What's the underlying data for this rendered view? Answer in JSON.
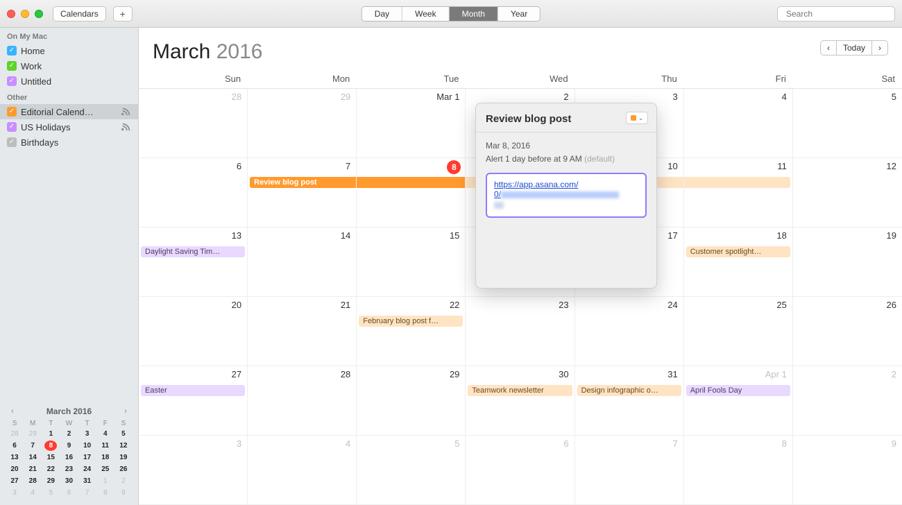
{
  "toolbar": {
    "calendars_btn": "Calendars",
    "views": {
      "day": "Day",
      "week": "Week",
      "month": "Month",
      "year": "Year",
      "active": "Month"
    },
    "search_placeholder": "Search"
  },
  "sidebar": {
    "group1_title": "On My Mac",
    "group1": [
      {
        "label": "Home",
        "color": "blue",
        "checked": true
      },
      {
        "label": "Work",
        "color": "green",
        "checked": true
      },
      {
        "label": "Untitled",
        "color": "purple",
        "checked": true
      }
    ],
    "group2_title": "Other",
    "group2": [
      {
        "label": "Editorial Calend…",
        "color": "orange",
        "checked": true,
        "rss": true,
        "selected": true
      },
      {
        "label": "US Holidays",
        "color": "purple",
        "checked": true,
        "rss": true
      },
      {
        "label": "Birthdays",
        "color": "gray",
        "checked": true
      }
    ]
  },
  "miniCal": {
    "title": "March 2016",
    "dow": [
      "S",
      "M",
      "T",
      "W",
      "T",
      "F",
      "S"
    ],
    "rows": [
      [
        {
          "n": "28",
          "dim": true
        },
        {
          "n": "29",
          "dim": true
        },
        {
          "n": "1",
          "bold": true
        },
        {
          "n": "2",
          "bold": true
        },
        {
          "n": "3",
          "bold": true
        },
        {
          "n": "4",
          "bold": true
        },
        {
          "n": "5",
          "bold": true
        }
      ],
      [
        {
          "n": "6",
          "bold": true
        },
        {
          "n": "7",
          "bold": true
        },
        {
          "n": "8",
          "today": true
        },
        {
          "n": "9",
          "bold": true
        },
        {
          "n": "10",
          "bold": true
        },
        {
          "n": "11",
          "bold": true
        },
        {
          "n": "12",
          "bold": true
        }
      ],
      [
        {
          "n": "13",
          "bold": true
        },
        {
          "n": "14",
          "bold": true
        },
        {
          "n": "15",
          "bold": true
        },
        {
          "n": "16",
          "bold": true
        },
        {
          "n": "17",
          "bold": true
        },
        {
          "n": "18",
          "bold": true
        },
        {
          "n": "19",
          "bold": true
        }
      ],
      [
        {
          "n": "20",
          "bold": true
        },
        {
          "n": "21",
          "bold": true
        },
        {
          "n": "22",
          "bold": true
        },
        {
          "n": "23",
          "bold": true
        },
        {
          "n": "24",
          "bold": true
        },
        {
          "n": "25",
          "bold": true
        },
        {
          "n": "26",
          "bold": true
        }
      ],
      [
        {
          "n": "27",
          "bold": true
        },
        {
          "n": "28",
          "bold": true
        },
        {
          "n": "29",
          "bold": true
        },
        {
          "n": "30",
          "bold": true
        },
        {
          "n": "31",
          "bold": true
        },
        {
          "n": "1",
          "dim": true
        },
        {
          "n": "2",
          "dim": true
        }
      ],
      [
        {
          "n": "3",
          "dim": true
        },
        {
          "n": "4",
          "dim": true
        },
        {
          "n": "5",
          "dim": true
        },
        {
          "n": "6",
          "dim": true
        },
        {
          "n": "7",
          "dim": true
        },
        {
          "n": "8",
          "dim": true
        },
        {
          "n": "9",
          "dim": true
        }
      ]
    ]
  },
  "header": {
    "month": "March",
    "year": "2016",
    "today_btn": "Today",
    "dow": [
      "Sun",
      "Mon",
      "Tue",
      "Wed",
      "Thu",
      "Fri",
      "Sat"
    ]
  },
  "calendar": {
    "rows": [
      [
        {
          "num": "28",
          "dim": true
        },
        {
          "num": "29",
          "dim": true
        },
        {
          "num": "Mar 1"
        },
        {
          "num": "2"
        },
        {
          "num": "3"
        },
        {
          "num": "4"
        },
        {
          "num": "5"
        }
      ],
      [
        {
          "num": "6"
        },
        {
          "num": "7",
          "events": [
            {
              "text": "Review blog post",
              "cls": "orange-solid span left-round",
              "indentLeft": true
            }
          ]
        },
        {
          "num": "8",
          "today": true,
          "events": [
            {
              "text": "",
              "cls": "orange-solid span"
            }
          ]
        },
        {
          "num": "9",
          "events": [
            {
              "text": "",
              "cls": "orange-soft span"
            }
          ]
        },
        {
          "num": "10",
          "events": [
            {
              "text": "",
              "cls": "orange-soft span"
            }
          ]
        },
        {
          "num": "11",
          "events": [
            {
              "text": "",
              "cls": "orange-soft span right-round"
            }
          ]
        },
        {
          "num": "12"
        }
      ],
      [
        {
          "num": "13",
          "events": [
            {
              "text": "Daylight Saving Tim…",
              "cls": "purple-soft"
            }
          ]
        },
        {
          "num": "14"
        },
        {
          "num": "15"
        },
        {
          "num": "16"
        },
        {
          "num": "17"
        },
        {
          "num": "18",
          "events": [
            {
              "text": "Customer spotlight…",
              "cls": "orange-soft"
            }
          ]
        },
        {
          "num": "19"
        }
      ],
      [
        {
          "num": "20"
        },
        {
          "num": "21"
        },
        {
          "num": "22",
          "events": [
            {
              "text": "February blog post f…",
              "cls": "orange-soft"
            }
          ]
        },
        {
          "num": "23"
        },
        {
          "num": "24"
        },
        {
          "num": "25"
        },
        {
          "num": "26"
        }
      ],
      [
        {
          "num": "27",
          "events": [
            {
              "text": "Easter",
              "cls": "purple-soft"
            }
          ]
        },
        {
          "num": "28"
        },
        {
          "num": "29"
        },
        {
          "num": "30",
          "events": [
            {
              "text": "Teamwork newsletter",
              "cls": "orange-soft"
            }
          ]
        },
        {
          "num": "31",
          "events": [
            {
              "text": "Design infographic o…",
              "cls": "orange-soft"
            }
          ]
        },
        {
          "num": "Apr 1",
          "dim": true,
          "events": [
            {
              "text": "April Fools Day",
              "cls": "purple-soft"
            }
          ]
        },
        {
          "num": "2",
          "dim": true
        }
      ],
      [
        {
          "num": "3",
          "dim": true
        },
        {
          "num": "4",
          "dim": true
        },
        {
          "num": "5",
          "dim": true
        },
        {
          "num": "6",
          "dim": true
        },
        {
          "num": "7",
          "dim": true
        },
        {
          "num": "8",
          "dim": true
        },
        {
          "num": "9",
          "dim": true
        }
      ]
    ]
  },
  "popover": {
    "title": "Review blog post",
    "date": "Mar 8, 2016",
    "alert": "Alert 1 day before at 9 AM",
    "alert_suffix": "(default)",
    "url_visible": "https://app.asana.com/",
    "url_line2": "0/"
  }
}
